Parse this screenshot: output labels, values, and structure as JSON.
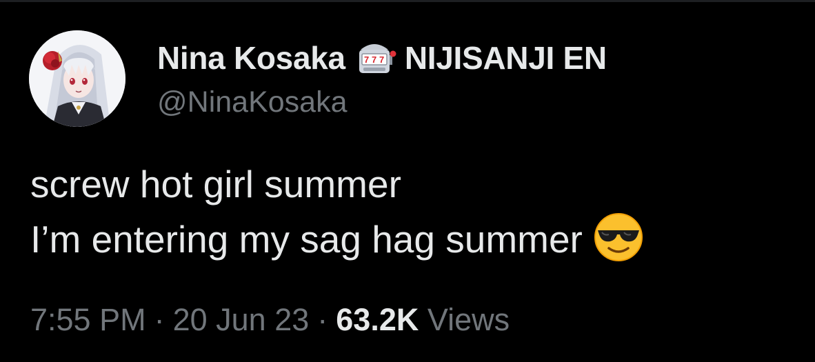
{
  "tweet": {
    "author": {
      "display_name": "Nina Kosaka",
      "badge_icon": "slot-machine-icon",
      "affiliation": "NIJISANJI EN",
      "handle": "@NinaKosaka"
    },
    "text_lines": [
      "screw hot girl summer",
      "I’m entering my sag hag summer"
    ],
    "emoji": "smiling-face-with-sunglasses-icon",
    "meta": {
      "time": "7:55 PM",
      "separator": "·",
      "date": "20 Jun 23",
      "views_count": "63.2K",
      "views_label": "Views"
    }
  },
  "colors": {
    "background": "#000000",
    "primary_text": "#e7e9ea",
    "secondary_text": "#71767b"
  }
}
